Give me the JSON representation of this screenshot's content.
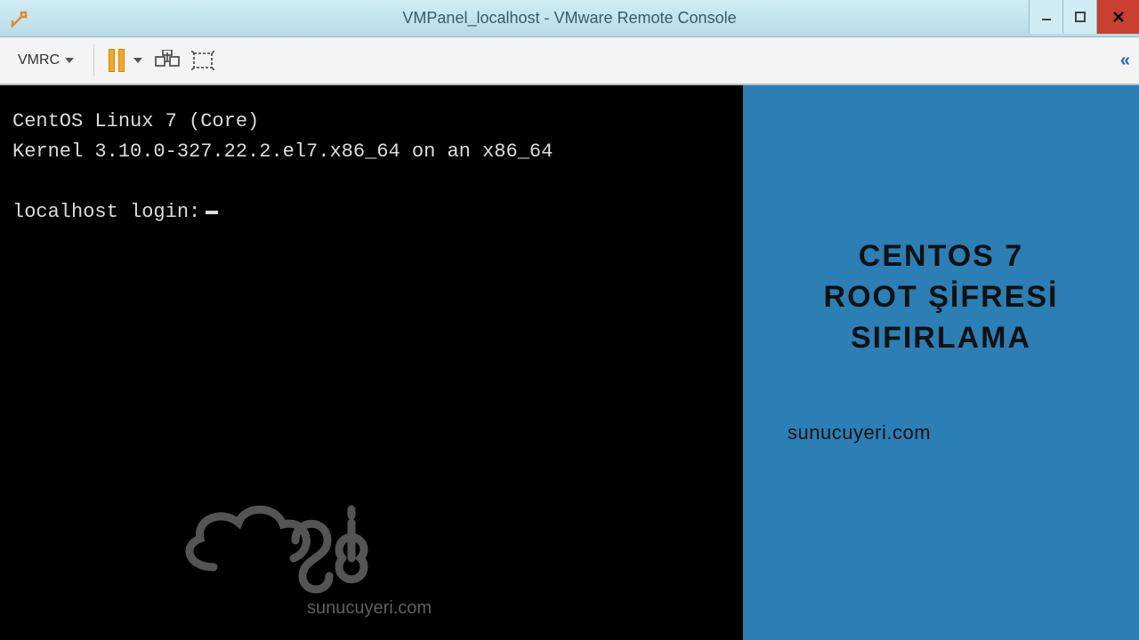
{
  "window": {
    "title": "VMPanel_localhost - VMware Remote Console"
  },
  "toolbar": {
    "vmrc_label": "VMRC"
  },
  "console": {
    "line1": "CentOS Linux 7 (Core)",
    "line2": "Kernel 3.10.0-327.22.2.el7.x86_64 on an x86_64",
    "prompt": "localhost login:"
  },
  "overlay": {
    "headline_l1": "CENTOS 7",
    "headline_l2": "ROOT ŞİFRESİ",
    "headline_l3": "SIFIRLAMA",
    "site": "sunucuyeri.com"
  },
  "watermark": {
    "text": "sunucuyeri.com"
  }
}
